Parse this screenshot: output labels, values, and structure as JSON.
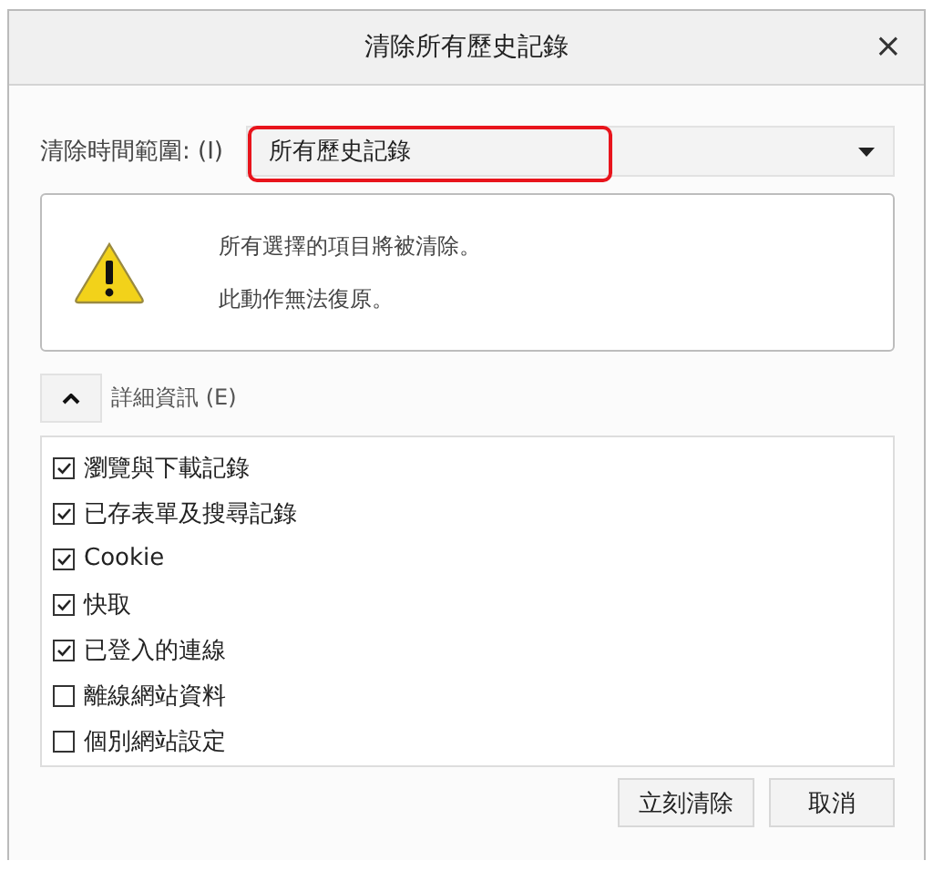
{
  "window": {
    "title": "清除所有歷史記錄",
    "close": "×"
  },
  "time_range": {
    "label": "清除時間範圍: (I)",
    "value": "所有歷史記錄",
    "highlighted": true
  },
  "warning": {
    "lines": [
      "所有選擇的項目將被清除。",
      "此動作無法復原。"
    ]
  },
  "details": {
    "label": "詳細資訊 (E)",
    "expanded": true
  },
  "items": [
    {
      "label": "瀏覽與下載記錄",
      "checked": true
    },
    {
      "label": "已存表單及搜尋記錄",
      "checked": true
    },
    {
      "label": "Cookie",
      "checked": true
    },
    {
      "label": "快取",
      "checked": true
    },
    {
      "label": "已登入的連線",
      "checked": true
    },
    {
      "label": "離線網站資料",
      "checked": false
    },
    {
      "label": "個別網站設定",
      "checked": false
    }
  ],
  "buttons": [
    "立刻清除",
    "取消"
  ]
}
